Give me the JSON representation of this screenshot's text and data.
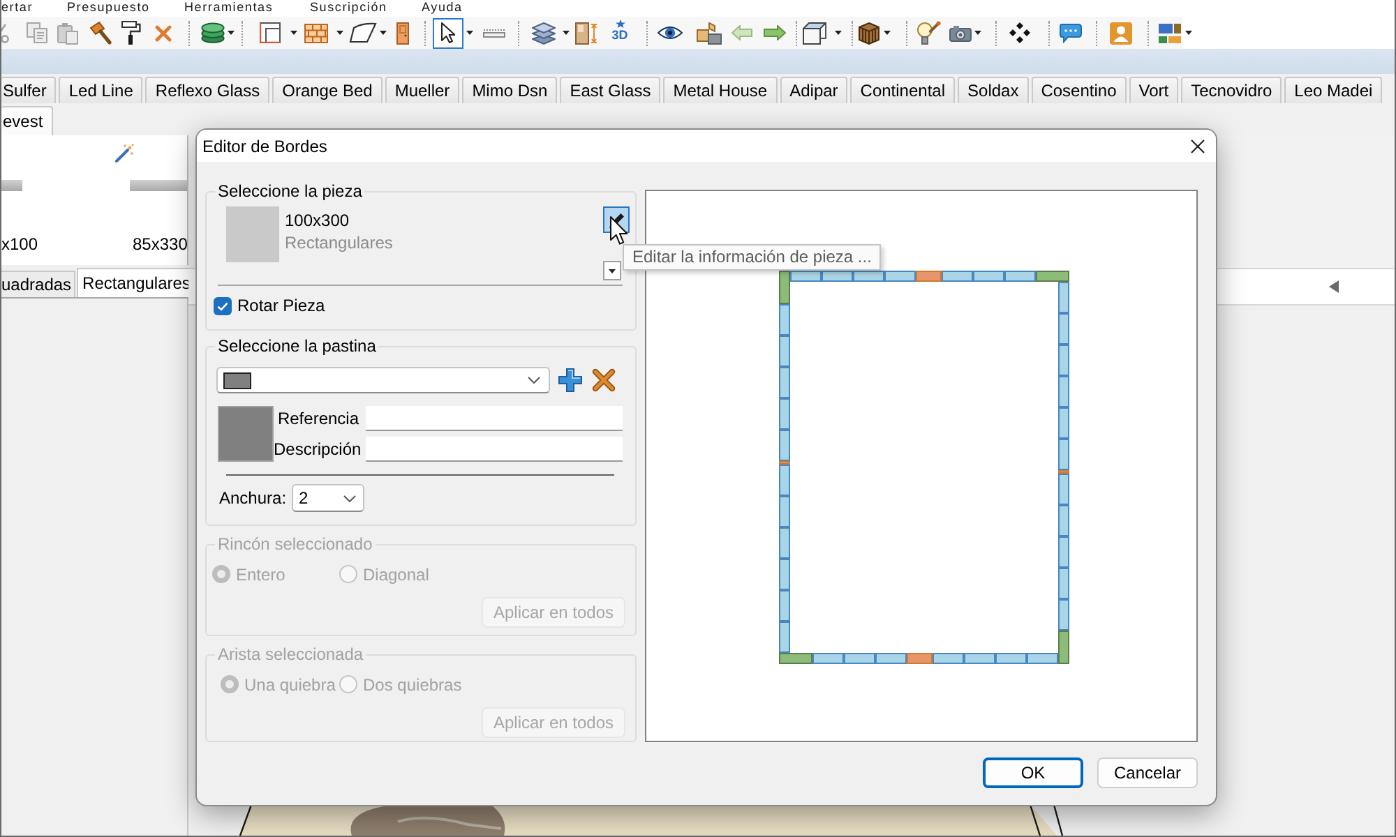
{
  "menu_bar": [
    {
      "label": "ertar"
    },
    {
      "label": "Presupuesto"
    },
    {
      "label": "Herramientas"
    },
    {
      "label": "Suscripción"
    },
    {
      "label": "Ayuda"
    }
  ],
  "toolbar": {
    "clipboard_tools": [
      {
        "disabled": true
      },
      {
        "disabled": true
      },
      {
        "disabled": true
      }
    ],
    "select_tool": {
      "selected": true
    },
    "view_3d_label": "3D"
  },
  "supplier_tab_rows": [
    {
      "tabs": [
        {
          "label": "Sulfer",
          "selected": false
        },
        {
          "label": "Led Line",
          "selected": false
        },
        {
          "label": "Reflexo Glass",
          "selected": false
        },
        {
          "label": "Orange Bed",
          "selected": false
        },
        {
          "label": "Mueller",
          "selected": false
        },
        {
          "label": "Mimo Dsn",
          "selected": false
        },
        {
          "label": "East Glass",
          "selected": false
        },
        {
          "label": "Metal House",
          "selected": false
        },
        {
          "label": "Adipar",
          "selected": false
        },
        {
          "label": "Continental",
          "selected": false
        },
        {
          "label": "Soldax",
          "selected": false
        },
        {
          "label": "Cosentino",
          "selected": false
        },
        {
          "label": "Vort",
          "selected": false
        },
        {
          "label": "Tecnovidro",
          "selected": false
        },
        {
          "label": "Leo Madei",
          "selected": false
        }
      ]
    },
    {
      "tabs": [
        {
          "label": "evest",
          "selected": true
        }
      ]
    }
  ],
  "library": {
    "items": [
      {
        "label": "x100",
        "marked": false
      },
      {
        "label": "85x330",
        "marked": true
      }
    ],
    "tabs": [
      {
        "label": "uadradas",
        "selected": false
      },
      {
        "label": "Rectangulares",
        "selected": true
      }
    ]
  },
  "dialog": {
    "title": "Editor de Bordes",
    "piece_group": {
      "title": "Seleccione la pieza",
      "piece": {
        "name": "100x300",
        "category": "Rectangulares"
      },
      "edit_button": {
        "hovered": true,
        "tooltip": "Editar la información de pieza ..."
      },
      "rotate_checkbox": {
        "label": "Rotar Pieza",
        "checked": true
      }
    },
    "grout_group": {
      "title": "Seleccione la pastina",
      "fields": [
        {
          "label": "Referencia"
        },
        {
          "label": "Descripción"
        }
      ],
      "width_select": {
        "label": "Anchura:",
        "value": "2"
      }
    },
    "corner_group": {
      "title": "Rincón seleccionado",
      "disabled": true,
      "options": [
        {
          "label": "Entero",
          "selected": true
        },
        {
          "label": "Diagonal",
          "selected": false
        }
      ],
      "apply_button": "Aplicar en todos"
    },
    "edge_group": {
      "title": "Arista seleccionada",
      "disabled": true,
      "options": [
        {
          "label": "Una quiebra",
          "selected": true
        },
        {
          "label": "Dos quiebras",
          "selected": false
        }
      ],
      "apply_button": "Aplicar en todos"
    },
    "border_preview": {
      "corners": [
        {
          "kind": "vertical"
        },
        {
          "kind": "horizontal"
        },
        {
          "kind": "vertical"
        },
        {
          "kind": "horizontal"
        }
      ],
      "edges": [
        {
          "tiles": [
            {
              "kind": "full"
            },
            {
              "kind": "full"
            },
            {
              "kind": "full"
            },
            {
              "kind": "full"
            },
            {
              "kind": "cut"
            },
            {
              "kind": "full"
            },
            {
              "kind": "full"
            },
            {
              "kind": "full"
            }
          ]
        },
        {
          "tiles": [
            {
              "kind": "full"
            },
            {
              "kind": "full"
            },
            {
              "kind": "full"
            },
            {
              "kind": "full"
            },
            {
              "kind": "full"
            },
            {
              "kind": "full"
            },
            {
              "kind": "cut"
            },
            {
              "kind": "full"
            },
            {
              "kind": "full"
            },
            {
              "kind": "full"
            },
            {
              "kind": "full"
            },
            {
              "kind": "full"
            }
          ]
        },
        {
          "tiles": [
            {
              "kind": "full"
            },
            {
              "kind": "full"
            },
            {
              "kind": "full"
            },
            {
              "kind": "cut"
            },
            {
              "kind": "full"
            },
            {
              "kind": "full"
            },
            {
              "kind": "full"
            },
            {
              "kind": "full"
            }
          ]
        },
        {
          "tiles": [
            {
              "kind": "full"
            },
            {
              "kind": "full"
            },
            {
              "kind": "full"
            },
            {
              "kind": "full"
            },
            {
              "kind": "full"
            },
            {
              "kind": "cut"
            },
            {
              "kind": "full"
            },
            {
              "kind": "full"
            },
            {
              "kind": "full"
            },
            {
              "kind": "full"
            },
            {
              "kind": "full"
            },
            {
              "kind": "full"
            }
          ]
        }
      ]
    },
    "buttons": [
      {
        "label": "OK",
        "kind": "default"
      },
      {
        "label": "Cancelar",
        "kind": "normal"
      }
    ]
  }
}
